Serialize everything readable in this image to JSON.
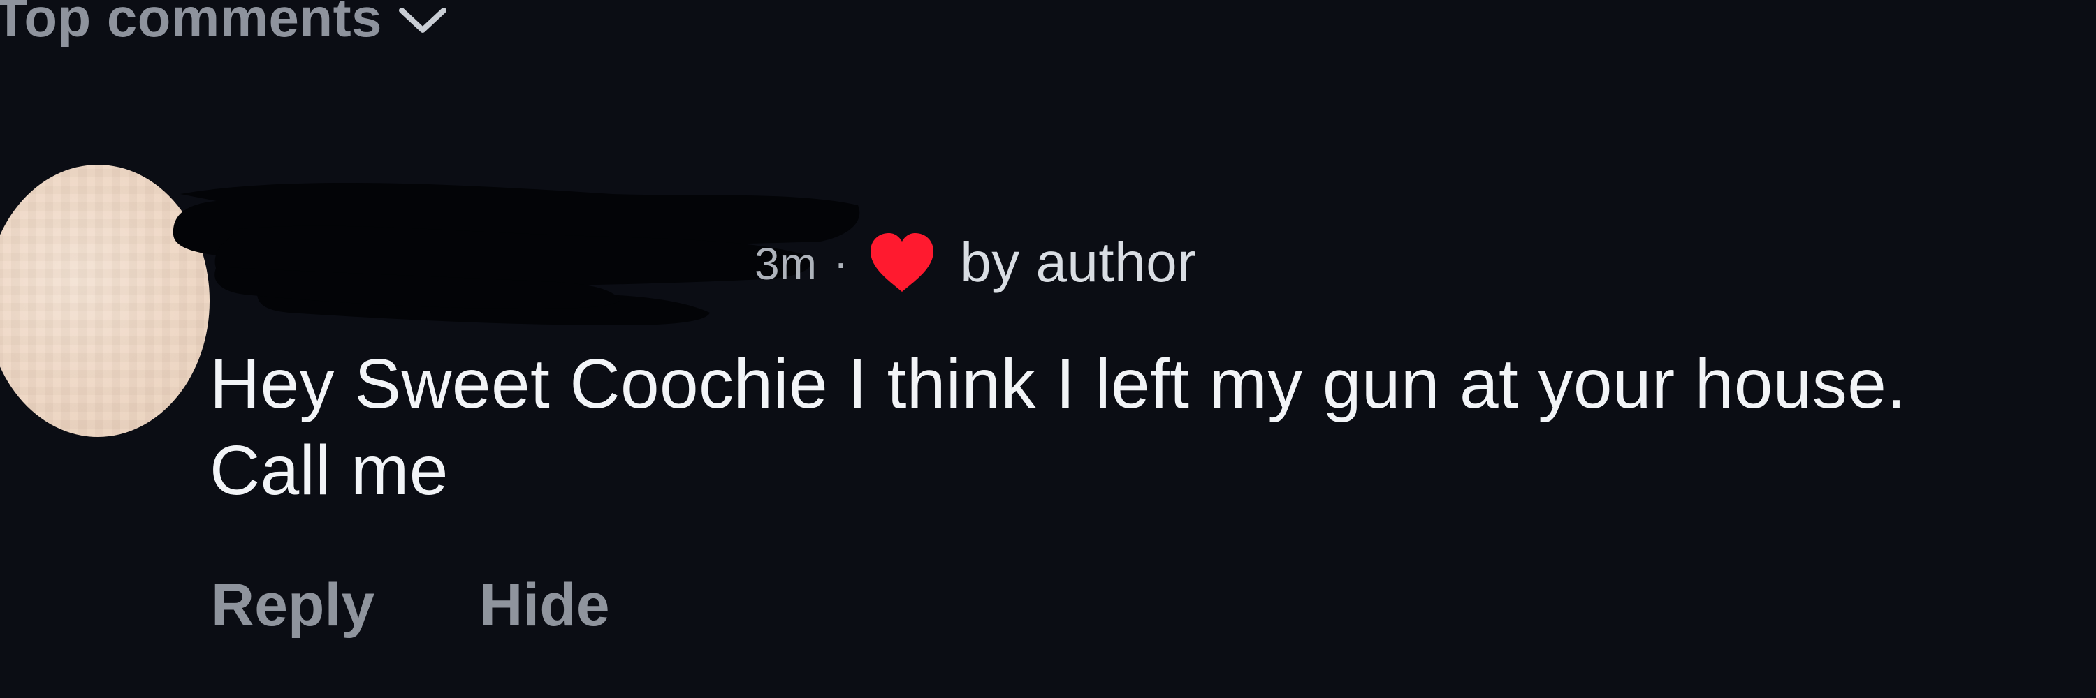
{
  "comments_section": {
    "sort_label": "Top comments",
    "sort_icon": "chevron-down-icon"
  },
  "comment": {
    "avatar": "user-avatar",
    "timestamp": "3m",
    "liked_indicator": {
      "icon": "heart-icon",
      "label": "by author",
      "color": "#ff1a2f"
    },
    "text": "Hey Sweet Coochie I think I left my gun at your house. Call me",
    "actions": {
      "reply": "Reply",
      "hide": "Hide"
    }
  },
  "colors": {
    "background": "#0b0d14",
    "primary_text": "#f2f4f7",
    "secondary_text": "#8f949d",
    "avatar": "#eed7c4"
  }
}
